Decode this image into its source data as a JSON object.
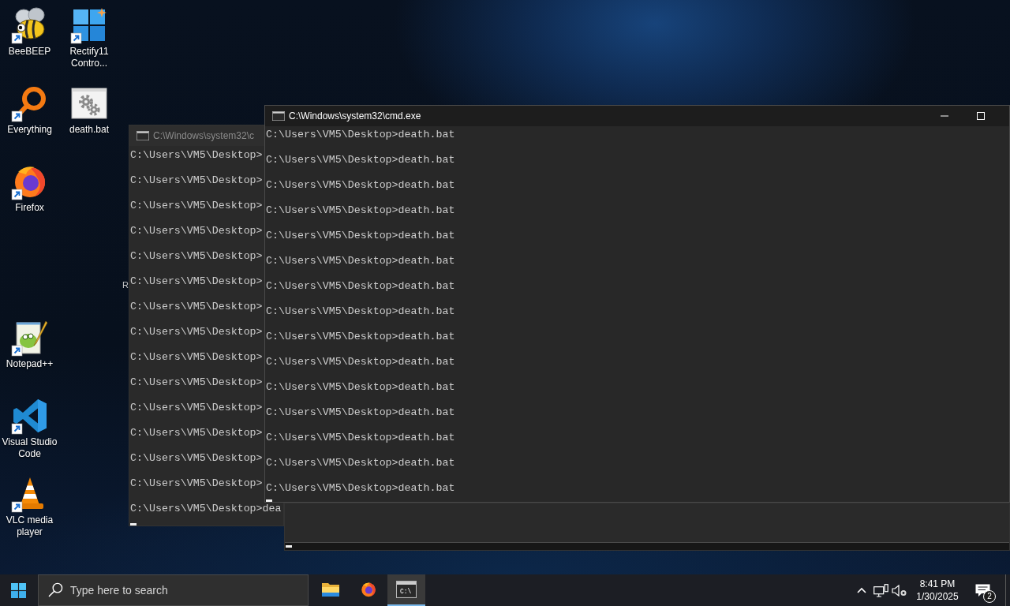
{
  "desktop": {
    "icons": [
      {
        "label": "BeeBEEP",
        "kind": "bee",
        "shortcut": true
      },
      {
        "label": "Rectify11 Contro...",
        "kind": "tiles",
        "shortcut": true
      },
      {
        "label": "Everything",
        "kind": "ring",
        "shortcut": true
      },
      {
        "label": "death.bat",
        "kind": "batch",
        "shortcut": false
      },
      {
        "label": "Firefox",
        "kind": "firefox",
        "shortcut": true
      },
      {
        "label": "Notepad++",
        "kind": "notepad",
        "shortcut": true
      },
      {
        "label": "Visual Studio Code",
        "kind": "vscode",
        "shortcut": true
      },
      {
        "label": "VLC media player",
        "kind": "cone",
        "shortcut": true
      }
    ],
    "clipped_text": "R"
  },
  "windows": [
    {
      "title": "C:\\Windows\\system32\\c",
      "focused": false,
      "lines": [
        "C:\\Users\\VM5\\Desktop>",
        "C:\\Users\\VM5\\Desktop>",
        "C:\\Users\\VM5\\Desktop>",
        "C:\\Users\\VM5\\Desktop>",
        "C:\\Users\\VM5\\Desktop>",
        "C:\\Users\\VM5\\Desktop>",
        "C:\\Users\\VM5\\Desktop>",
        "C:\\Users\\VM5\\Desktop>",
        "C:\\Users\\VM5\\Desktop>",
        "C:\\Users\\VM5\\Desktop>",
        "C:\\Users\\VM5\\Desktop>",
        "C:\\Users\\VM5\\Desktop>",
        "C:\\Users\\VM5\\Desktop>",
        "C:\\Users\\VM5\\Desktop>",
        "C:\\Users\\VM5\\Desktop>dea"
      ]
    },
    {
      "focused": false
    },
    {
      "title": "C:\\Windows\\system32\\cmd.exe",
      "focused": true,
      "lines": [
        "C:\\Users\\VM5\\Desktop>death.bat",
        "C:\\Users\\VM5\\Desktop>death.bat",
        "C:\\Users\\VM5\\Desktop>death.bat",
        "C:\\Users\\VM5\\Desktop>death.bat",
        "C:\\Users\\VM5\\Desktop>death.bat",
        "C:\\Users\\VM5\\Desktop>death.bat",
        "C:\\Users\\VM5\\Desktop>death.bat",
        "C:\\Users\\VM5\\Desktop>death.bat",
        "C:\\Users\\VM5\\Desktop>death.bat",
        "C:\\Users\\VM5\\Desktop>death.bat",
        "C:\\Users\\VM5\\Desktop>death.bat",
        "C:\\Users\\VM5\\Desktop>death.bat",
        "C:\\Users\\VM5\\Desktop>death.bat",
        "C:\\Users\\VM5\\Desktop>death.bat",
        "C:\\Users\\VM5\\Desktop>death.bat"
      ]
    }
  ],
  "taskbar": {
    "search": {
      "placeholder": "Type here to search"
    },
    "apps": [
      {
        "kind": "folder",
        "selected": false
      },
      {
        "kind": "firefox",
        "selected": false
      },
      {
        "kind": "terminal",
        "selected": true,
        "icon_text": "C:\\"
      }
    ],
    "clock": {
      "time": "8:41 PM",
      "date": "1/30/2025"
    },
    "notifications": {
      "count": "2"
    }
  }
}
